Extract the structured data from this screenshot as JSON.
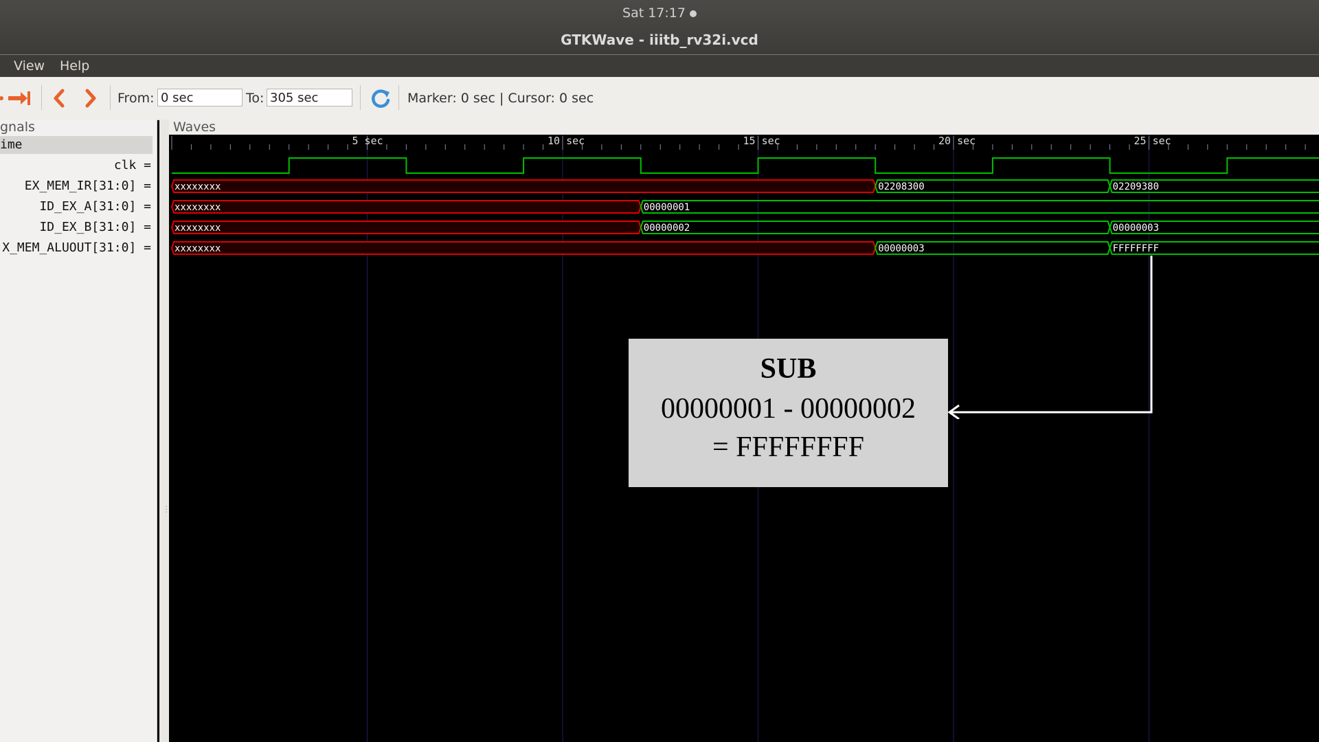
{
  "system": {
    "clock": "Sat 17:17"
  },
  "window": {
    "title": "GTKWave - iiitb_rv32i.vcd"
  },
  "menu": {
    "items": [
      "View",
      "Help"
    ]
  },
  "toolbar": {
    "from_label": "From:",
    "from_value": "0 sec",
    "to_label": "To:",
    "to_value": "305 sec",
    "status": "Marker: 0 sec  |  Cursor: 0 sec"
  },
  "signals": {
    "header": "gnals",
    "time_label": "ime",
    "rows": [
      "clk =",
      "EX_MEM_IR[31:0] =",
      "ID_EX_A[31:0] =",
      "ID_EX_B[31:0] =",
      "X_MEM_ALUOUT[31:0] ="
    ]
  },
  "waves": {
    "header": "Waves",
    "tick_labels": [
      "5 sec",
      "10 sec",
      "15 sec",
      "20 sec",
      "25 sec"
    ],
    "tick_values": [
      5,
      10,
      15,
      20,
      25
    ],
    "buses": [
      {
        "name": "EX_MEM_IR",
        "segments": [
          {
            "t0": 0,
            "t1": 18,
            "value": "xxxxxxxx",
            "state": "x"
          },
          {
            "t0": 18,
            "t1": 24,
            "value": "02208300",
            "state": "ok"
          },
          {
            "t0": 24,
            "t1": 30,
            "value": "02209380",
            "state": "ok"
          }
        ]
      },
      {
        "name": "ID_EX_A",
        "segments": [
          {
            "t0": 0,
            "t1": 12,
            "value": "xxxxxxxx",
            "state": "x"
          },
          {
            "t0": 12,
            "t1": 30,
            "value": "00000001",
            "state": "ok"
          }
        ]
      },
      {
        "name": "ID_EX_B",
        "segments": [
          {
            "t0": 0,
            "t1": 12,
            "value": "xxxxxxxx",
            "state": "x"
          },
          {
            "t0": 12,
            "t1": 24,
            "value": "00000002",
            "state": "ok"
          },
          {
            "t0": 24,
            "t1": 30,
            "value": "00000003",
            "state": "ok"
          }
        ]
      },
      {
        "name": "X_MEM_ALUOUT",
        "segments": [
          {
            "t0": 0,
            "t1": 18,
            "value": "xxxxxxxx",
            "state": "x"
          },
          {
            "t0": 18,
            "t1": 24,
            "value": "00000003",
            "state": "ok"
          },
          {
            "t0": 24,
            "t1": 30,
            "value": "FFFFFFFF",
            "state": "ok"
          }
        ]
      }
    ],
    "clk_period": 6,
    "colors": {
      "ok": "#00c000",
      "x": "#e00000",
      "text": "#ffffff",
      "grid": "#1e1e5a"
    }
  },
  "annotation": {
    "line1": "SUB",
    "line2": "00000001 - 00000002",
    "line3": "= FFFFFFFF"
  }
}
